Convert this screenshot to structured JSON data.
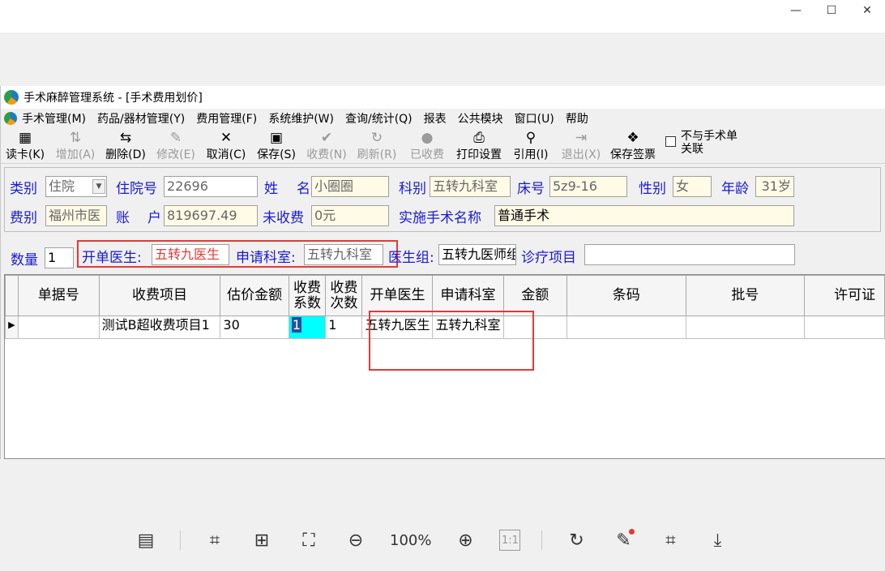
{
  "window": {
    "minimize": "—",
    "maximize": "☐",
    "close": "✕"
  },
  "app": {
    "title": "手术麻醉管理系统 - [手术费用划价]",
    "menu": [
      "手术管理(M)",
      "药品/器材管理(Y)",
      "费用管理(F)",
      "系统维护(W)",
      "查询/统计(Q)",
      "报表",
      "公共模块",
      "窗口(U)",
      "帮助"
    ]
  },
  "toolbar": {
    "items": [
      {
        "label": "读卡(K)",
        "icon": "card-reader-icon",
        "glyph": "▦",
        "enabled": true
      },
      {
        "label": "增加(A)",
        "icon": "add-icon",
        "glyph": "⇅",
        "enabled": false
      },
      {
        "label": "删除(D)",
        "icon": "delete-icon",
        "glyph": "⇆",
        "enabled": true
      },
      {
        "label": "修改(E)",
        "icon": "edit-icon",
        "glyph": "✎",
        "enabled": false
      },
      {
        "label": "取消(C)",
        "icon": "cancel-icon",
        "glyph": "✕",
        "enabled": true
      },
      {
        "label": "保存(S)",
        "icon": "save-icon",
        "glyph": "▣",
        "enabled": true
      },
      {
        "label": "收费(N)",
        "icon": "check-icon",
        "glyph": "✔",
        "enabled": false
      },
      {
        "label": "刷新(R)",
        "icon": "refresh-icon",
        "glyph": "↻",
        "enabled": false
      },
      {
        "label": "已收费",
        "icon": "charged-icon",
        "glyph": "●",
        "enabled": false
      },
      {
        "label": "打印设置",
        "icon": "printer-icon",
        "glyph": "⎙",
        "enabled": true
      },
      {
        "label": "引用(I)",
        "icon": "reference-icon",
        "glyph": "⚲",
        "enabled": true
      },
      {
        "label": "退出(X)",
        "icon": "exit-icon",
        "glyph": "⇥",
        "enabled": false
      },
      {
        "label": "保存签票",
        "icon": "book-icon",
        "glyph": "❖",
        "enabled": true
      }
    ],
    "checkbox_label": "不与手术单关联"
  },
  "patient": {
    "category_label": "类别",
    "category_value": "住院",
    "inpatient_no_label": "住院号",
    "inpatient_no_value": "22696",
    "name_label_1": "姓",
    "name_label_2": "名",
    "name_value": "小圈圈",
    "dept_label": "科别",
    "dept_value": "五转九科室",
    "bed_label": "床号",
    "bed_value": "5z9-16",
    "gender_label": "性别",
    "gender_value": "女",
    "age_label": "年龄",
    "age_value": "31岁",
    "fee_type_label": "费别",
    "fee_type_value": "福州市医",
    "account_label_1": "账",
    "account_label_2": "户",
    "account_value": "819697.49",
    "unpaid_label": "未收费",
    "unpaid_value": "0元",
    "surgery_label": "实施手术名称",
    "surgery_value": "普通手术"
  },
  "order": {
    "qty_label": "数量",
    "qty_value": "1",
    "doctor_label": "开单医生:",
    "doctor_value": "五转九医生",
    "dept_label": "申请科室:",
    "dept_value": "五转九科室",
    "group_label": "医生组:",
    "group_value": "五转九医师组",
    "item_label": "诊疗项目",
    "item_value": ""
  },
  "grid": {
    "headers": [
      "单据号",
      "收费项目",
      "估价金额",
      "收费\n系数",
      "收费\n次数",
      "开单医生",
      "申请科室",
      "金额",
      "条码",
      "批号",
      "许可证"
    ],
    "rows": [
      {
        "indicator": "▶",
        "doc_no": "",
        "item": "测试B超收费项目1",
        "estimate": "30",
        "factor": "1",
        "times": "1",
        "doctor": "五转九医生",
        "dept": "五转九科室",
        "amount": "",
        "barcode": "",
        "batch": "",
        "license": ""
      }
    ]
  },
  "viewer": {
    "zoom": "100%"
  }
}
